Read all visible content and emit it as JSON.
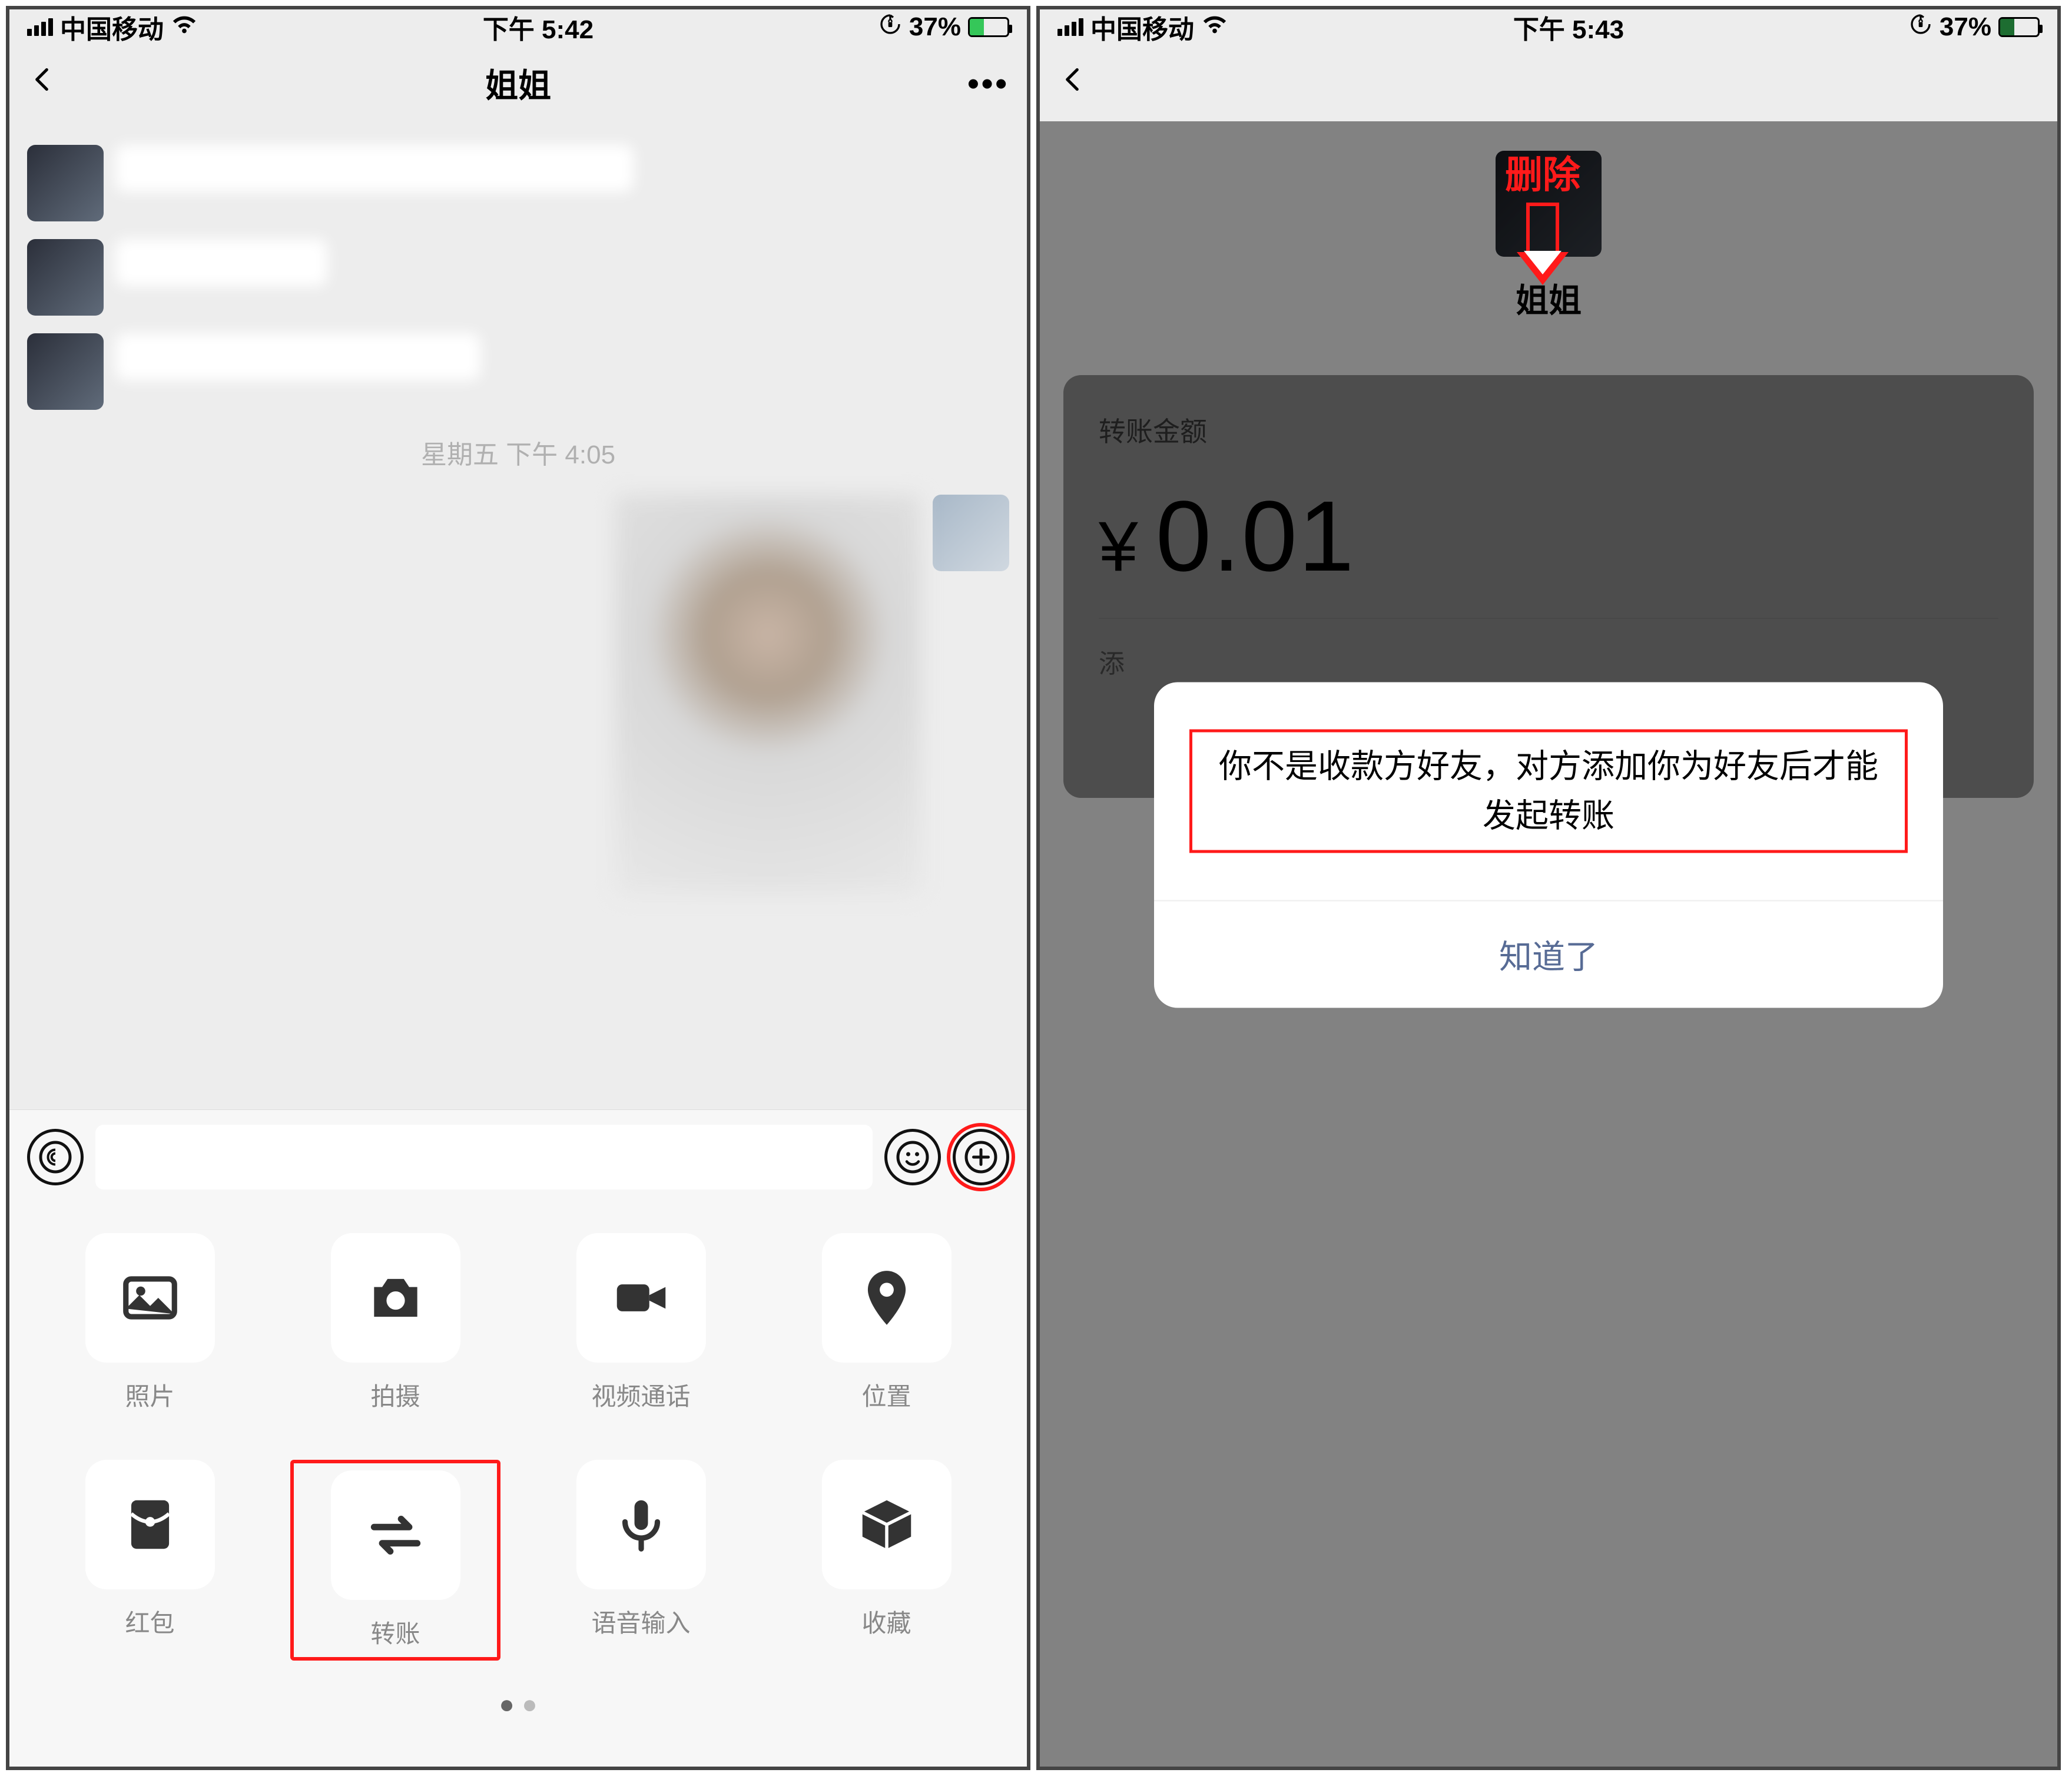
{
  "phone1": {
    "status": {
      "carrier": "中国移动",
      "time": "下午 5:42",
      "battery_pct": "37%"
    },
    "nav": {
      "title": "姐姐"
    },
    "chat": {
      "timestamp": "星期五 下午 4:05"
    },
    "panel": {
      "items": [
        {
          "icon": "photo",
          "label": "照片"
        },
        {
          "icon": "camera",
          "label": "拍摄"
        },
        {
          "icon": "video",
          "label": "视频通话"
        },
        {
          "icon": "pin",
          "label": "位置"
        },
        {
          "icon": "redpacket",
          "label": "红包"
        },
        {
          "icon": "transfer",
          "label": "转账"
        },
        {
          "icon": "mic",
          "label": "语音输入"
        },
        {
          "icon": "fav",
          "label": "收藏"
        }
      ]
    }
  },
  "phone2": {
    "status": {
      "carrier": "中国移动",
      "time": "下午 5:43",
      "battery_pct": "37%"
    },
    "profile": {
      "name": "姐姐"
    },
    "transfer": {
      "label": "转账金额",
      "currency": "¥",
      "amount": "0.01",
      "note_prefix": "添"
    },
    "modal": {
      "message": "你不是收款方好友，对方添加你为好友后才能发起转账",
      "ok": "知道了"
    },
    "annotation": {
      "label": "删除"
    }
  }
}
